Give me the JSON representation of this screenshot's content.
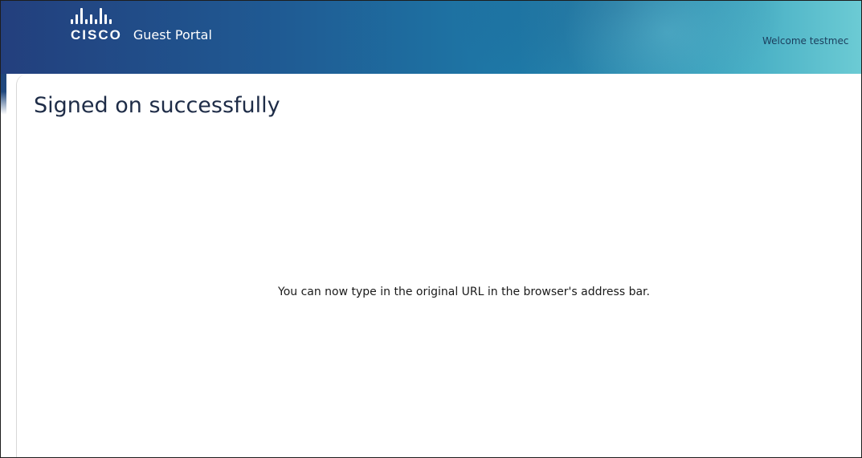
{
  "header": {
    "brand": "CISCO",
    "portal_title": "Guest Portal",
    "welcome_text": "Welcome testmec",
    "logo_icon": "cisco-bars-icon",
    "colors": {
      "gradient_start": "#233f7d",
      "gradient_end": "#6ccbd4"
    }
  },
  "main": {
    "heading": "Signed on successfully",
    "message": "You can now type in the original URL in the browser's address bar."
  }
}
